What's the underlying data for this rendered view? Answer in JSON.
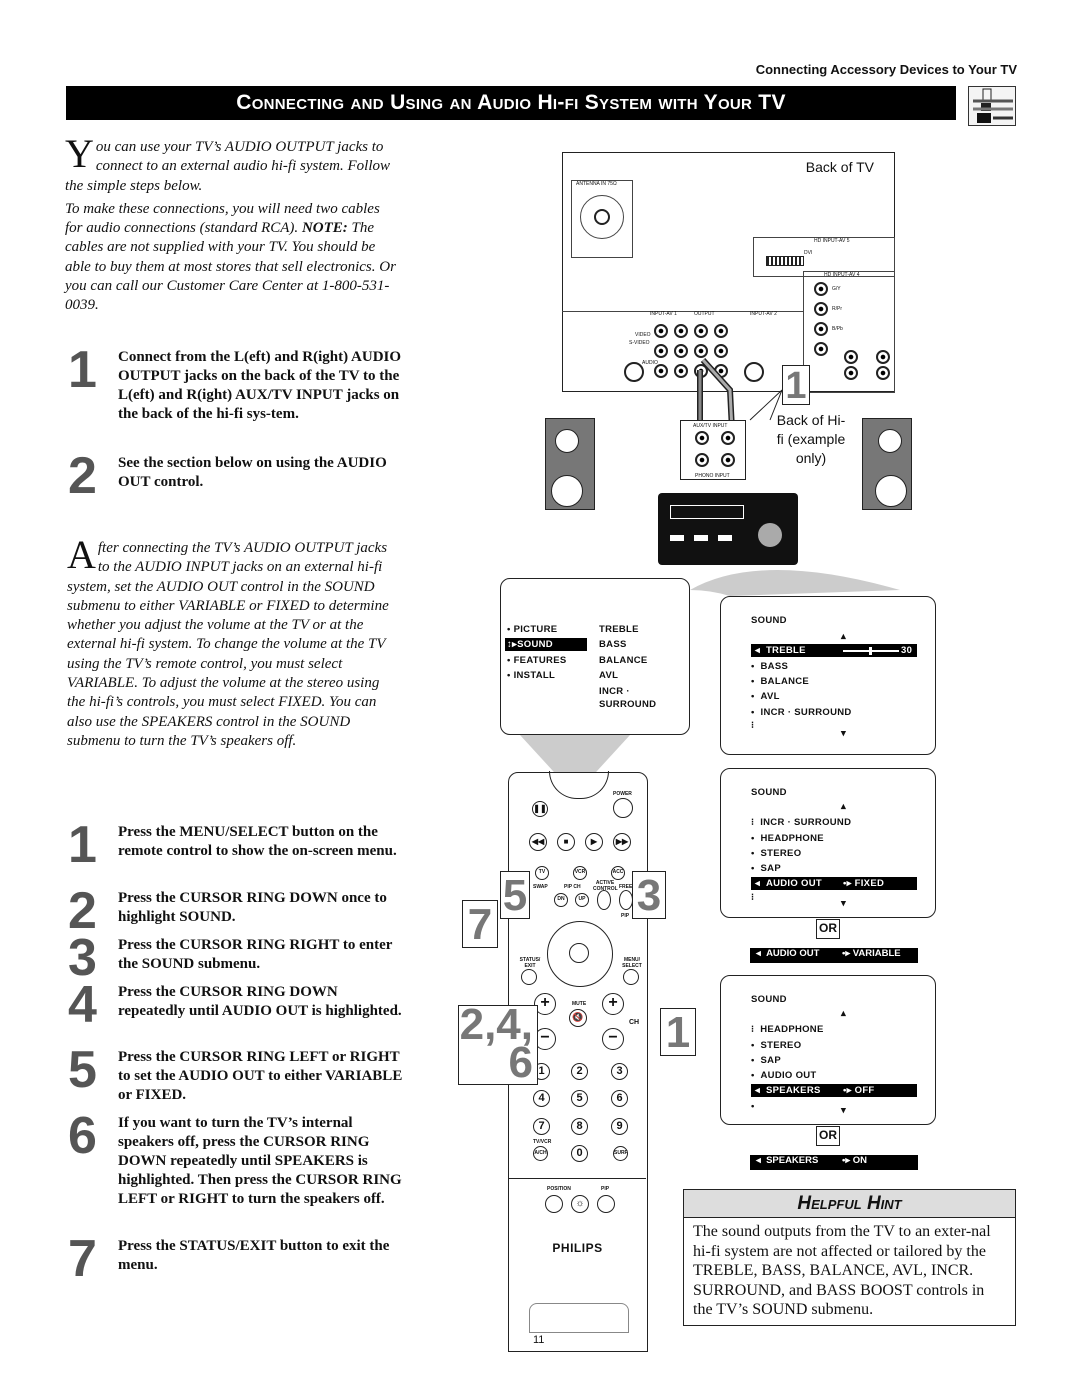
{
  "header": {
    "section": "Connecting Accessory Devices to Your TV"
  },
  "title": "Connecting and Using an Audio Hi-fi System with Your TV",
  "intro": {
    "dropcap": "Y",
    "p1": "ou can use your TV’s AUDIO OUTPUT jacks to connect to an external audio hi-fi system. Follow the simple steps below.",
    "p2": "To make these connections, you will need two cables for audio connections (standard RCA).",
    "note_label": "NOTE:",
    "note": " The cables are not supplied with your TV. You should be able to buy them at most stores that sell electronics. Or you can call our Customer Care Center at 1-800-531-0039."
  },
  "connect_steps": [
    {
      "num": "1",
      "text": "Connect from the L(eft) and R(ight) AUDIO OUTPUT jacks on the back of the TV to the L(eft) and R(ight) AUX/TV INPUT jacks on the back of the hi-fi sys-tem."
    },
    {
      "num": "2",
      "text": "See the section below on using the AUDIO OUT control."
    }
  ],
  "after": {
    "dropcap": "A",
    "text": "fter connecting the TV’s AUDIO OUTPUT jacks to the AUDIO INPUT jacks on an external hi-fi system, set the AUDIO OUT control in the SOUND submenu to either VARIABLE or FIXED to determine whether you adjust the volume at the TV or at the external hi-fi system. To change the volume at the TV using the TV’s remote control, you must select VARIABLE. To adjust the volume at the stereo using the hi-fi’s controls, you must select FIXED. You can also use the SPEAKERS control in the SOUND submenu to turn the TV’s speakers off."
  },
  "menu_steps": [
    {
      "num": "1",
      "text": "Press the MENU/SELECT button on the remote control to show the on-screen menu."
    },
    {
      "num": "2",
      "text": "Press the CURSOR RING DOWN once to highlight SOUND."
    },
    {
      "num": "3",
      "text": "Press the CURSOR RING RIGHT to enter the SOUND submenu."
    },
    {
      "num": "4",
      "text": "Press the CURSOR RING DOWN repeatedly until AUDIO OUT is highlighted."
    },
    {
      "num": "5",
      "text": "Press the CURSOR RING LEFT or RIGHT to set the AUDIO OUT to either VARIABLE or FIXED."
    },
    {
      "num": "6",
      "text": "If you want to turn the TV’s internal speakers off, press the CURSOR RING DOWN repeatedly until SPEAKERS is highlighted. Then press the CURSOR RING LEFT or RIGHT to turn the speakers off."
    },
    {
      "num": "7",
      "text": "Press the STATUS/EXIT button to exit the menu."
    }
  ],
  "diagram": {
    "back_of_tv": "Back of TV",
    "back_of_hifi": "Back of Hi-fi (example only)",
    "callout": "1",
    "panel_labels": {
      "antenna": "ANTENNA IN 75Ω",
      "hd_av5": "HD INPUT-AV 5",
      "dvi": "DVI",
      "hd_av4": "HD INPUT-AV 4",
      "input_av1": "INPUT-AV 1",
      "output": "OUTPUT",
      "input_av2": "INPUT-AV 2",
      "video": "VIDEO",
      "svideo": "S-VIDEO",
      "audio": "AUDIO",
      "gy": "G/Y",
      "rpr": "R/Pr",
      "bpb": "B/Pb",
      "aux_tv_input": "AUX/TV INPUT",
      "phono_input": "PHONO INPUT"
    }
  },
  "main_menu": {
    "items": [
      "PICTURE",
      "SOUND",
      "FEATURES",
      "INSTALL"
    ],
    "selected": "SOUND",
    "submenu": [
      "TREBLE",
      "BASS",
      "BALANCE",
      "AVL",
      "INCR · SURROUND"
    ]
  },
  "sound_menu_1": {
    "title": "SOUND",
    "highlight": {
      "label": "TREBLE",
      "value": "30",
      "slider_fraction": 0.5
    },
    "items": [
      "BASS",
      "BALANCE",
      "AVL",
      "INCR · SURROUND"
    ]
  },
  "sound_menu_2": {
    "title": "SOUND",
    "items": [
      "INCR · SURROUND",
      "HEADPHONE",
      "STEREO",
      "SAP"
    ],
    "highlight": {
      "label": "AUDIO OUT",
      "value": "FIXED"
    }
  },
  "or_label": "OR",
  "alt_audio_out": {
    "label": "AUDIO OUT",
    "value": "VARIABLE"
  },
  "sound_menu_3": {
    "title": "SOUND",
    "items": [
      "HEADPHONE",
      "STEREO",
      "SAP",
      "AUDIO OUT"
    ],
    "highlight": {
      "label": "SPEAKERS",
      "value": "OFF"
    }
  },
  "alt_speakers": {
    "label": "SPEAKERS",
    "value": "ON"
  },
  "remote": {
    "power": "POWER",
    "tv": "TV",
    "vcr": "VCR",
    "acc": "ACC",
    "swap": "SWAP",
    "pip_ch": "PIP CH",
    "active_control": "ACTIVE CONTROL",
    "freeze": "FREEZE",
    "dn": "DN",
    "up": "UP",
    "pip": "PIP",
    "status_exit": "STATUS/ EXIT",
    "menu_select": "MENU/ SELECT",
    "mute": "MUTE",
    "ch": "CH",
    "digits": [
      "1",
      "2",
      "3",
      "4",
      "5",
      "6",
      "7",
      "8",
      "9"
    ],
    "zero": "0",
    "tv_vcr": "TV/VCR",
    "ach": "A/CH",
    "surf": "SURF",
    "position": "POSITION",
    "pip2": "PIP",
    "brand": "PHILIPS"
  },
  "remote_callouts": {
    "c5": "5",
    "c3": "3",
    "c7": "7",
    "c246": "2,4, 6",
    "c1": "1"
  },
  "hint": {
    "title": "Helpful Hint",
    "text": "The sound outputs from the TV to an exter-nal hi-fi system are not affected or tailored by the TREBLE, BASS, BALANCE, AVL, INCR. SURROUND, and BASS BOOST controls in the TV’s SOUND submenu."
  },
  "page_number": "11"
}
